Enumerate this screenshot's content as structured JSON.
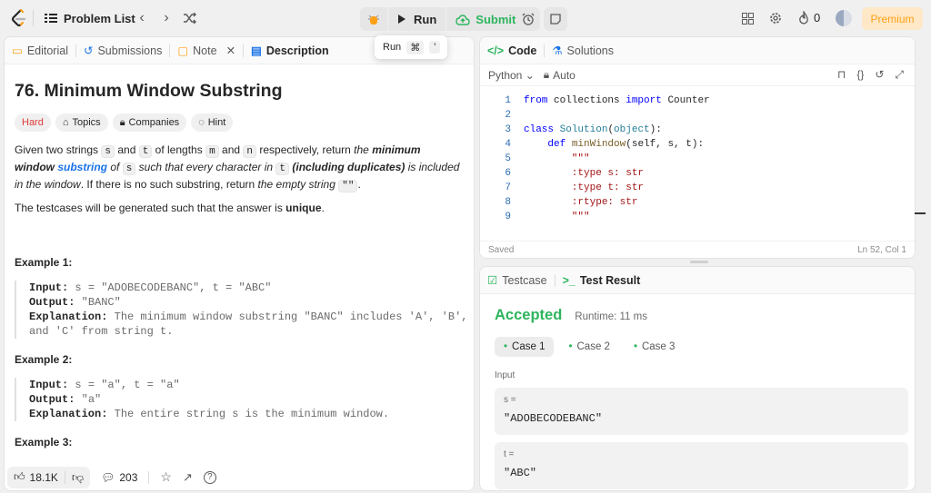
{
  "topbar": {
    "problem_list": "Problem List",
    "run": "Run",
    "submit": "Submit",
    "streak": "0",
    "premium": "Premium"
  },
  "tooltip": {
    "label": "Run",
    "k1": "⌘",
    "k2": "'"
  },
  "left": {
    "tabs": [
      "Editorial",
      "Submissions",
      "Note",
      "Description"
    ],
    "title": "76. Minimum Window Substring",
    "chips": [
      "Hard",
      "Topics",
      "Companies",
      "Hint"
    ],
    "desc": {
      "p1a": "Given two strings",
      "s": "s",
      "and": "and",
      "t": "t",
      "p1b": "of lengths",
      "m": "m",
      "and2": "and",
      "n": "n",
      "p1c": "respectively, return",
      "the": "the",
      "mws": "minimum window",
      "substr": "substring",
      "of": "of",
      "s2": "s",
      "such": "such that every character in",
      "t2": "t",
      "incl": "(including duplicates)",
      "included": "is included in the",
      "window": "window",
      "nosub": ". If there is no such substring, return",
      "empty": "the empty string",
      "q": "\"\"",
      "dot": "."
    },
    "p2a": "The testcases will be generated such that the answer is",
    "p2b": "unique",
    "p2c": ".",
    "ex1_title": "Example 1:",
    "ex1": {
      "in_l": "Input:",
      "in_v": "s = \"ADOBECODEBANC\", t = \"ABC\"",
      "out_l": "Output:",
      "out_v": "\"BANC\"",
      "exp_l": "Explanation:",
      "exp_v": "The minimum window substring \"BANC\" includes 'A', 'B',",
      "exp_v2": "and 'C' from string t."
    },
    "ex2_title": "Example 2:",
    "ex2": {
      "in_l": "Input:",
      "in_v": "s = \"a\", t = \"a\"",
      "out_l": "Output:",
      "out_v": "\"a\"",
      "exp_l": "Explanation:",
      "exp_v": "The entire string s is the minimum window."
    },
    "ex3_title": "Example 3:",
    "likes": "18.1K",
    "comments": "203"
  },
  "code": {
    "tabs": [
      "Code",
      "Solutions"
    ],
    "lang": "Python",
    "auto": "Auto",
    "lines": [
      {
        "n": "1",
        "t": "from collections import Counter"
      },
      {
        "n": "2",
        "t": ""
      },
      {
        "n": "3",
        "t": "class Solution(object):"
      },
      {
        "n": "4",
        "t": "    def minWindow(self, s, t):"
      },
      {
        "n": "5",
        "t": "        \"\"\""
      },
      {
        "n": "6",
        "t": "        :type s: str"
      },
      {
        "n": "7",
        "t": "        :type t: str"
      },
      {
        "n": "8",
        "t": "        :rtype: str"
      },
      {
        "n": "9",
        "t": "        \"\"\""
      }
    ],
    "saved": "Saved",
    "pos": "Ln 52, Col 1"
  },
  "result": {
    "tabs": [
      "Testcase",
      "Test Result"
    ],
    "status": "Accepted",
    "runtime": "Runtime: 11 ms",
    "cases": [
      "Case 1",
      "Case 2",
      "Case 3"
    ],
    "input_label": "Input",
    "s_label": "s =",
    "s_val": "\"ADOBECODEBANC\"",
    "t_label": "t =",
    "t_val": "\"ABC\""
  },
  "colors": {
    "accepted": "#2db55d",
    "hard": "#e03a3a",
    "premium": "#ffa116",
    "link": "#1a73e8"
  }
}
